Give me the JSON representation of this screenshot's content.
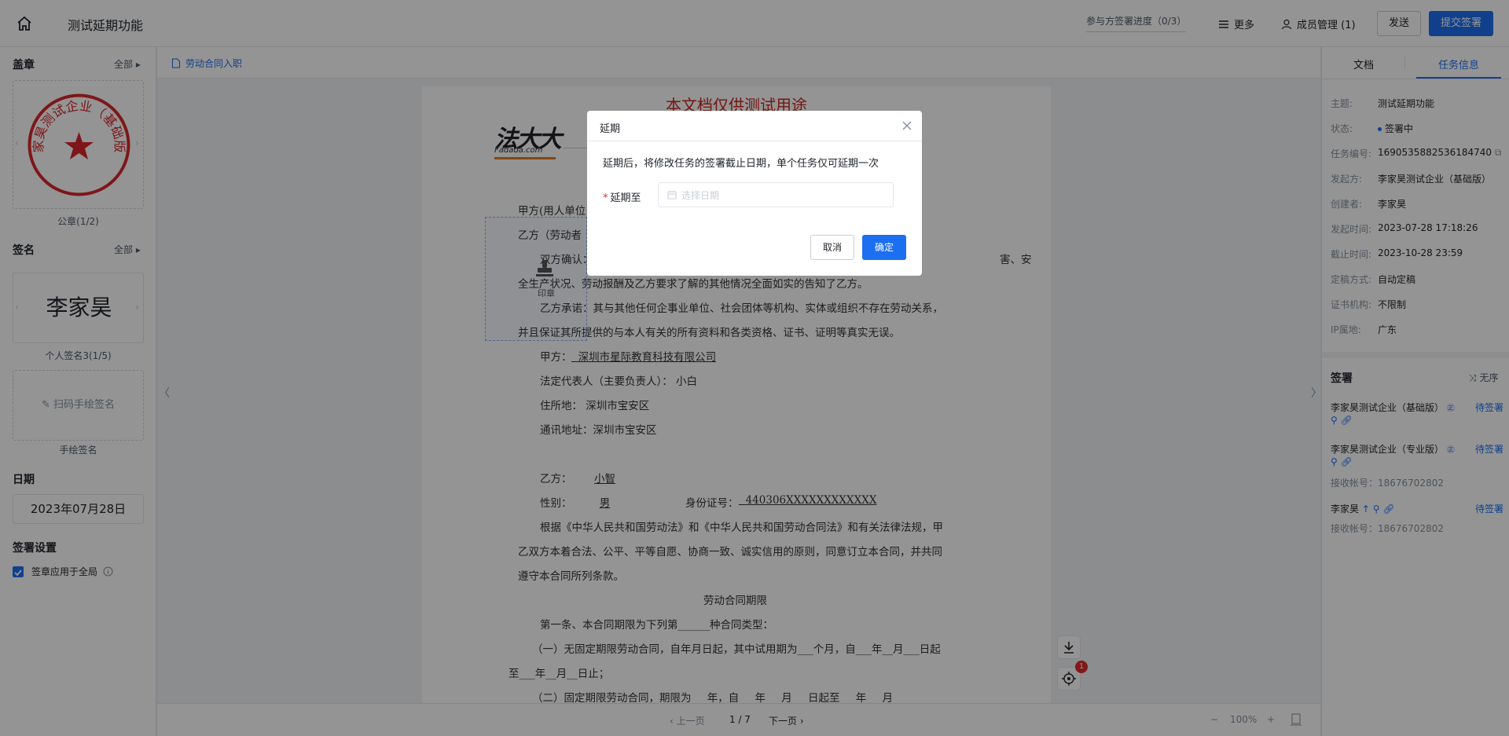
{
  "header": {
    "title": "测试延期功能",
    "progress": "参与方签署进度（0/3）",
    "more": "更多",
    "members": "成员管理 (1)",
    "send": "发送",
    "submit": "提交签署"
  },
  "left_panel": {
    "seal_heading": "盖章",
    "seal_all": "全部",
    "seal_text": "李家昊测试企业（基础版）",
    "seal_caption": "公章(1/2)",
    "sign_heading": "签名",
    "sign_all": "全部",
    "sign_name": "李家昊",
    "sign_caption": "个人签名3(1/5)",
    "hand_label": "扫码手绘签名",
    "hand_caption": "手绘签名",
    "date_heading": "日期",
    "date_value": "2023年07月28日",
    "settings_heading": "签署设置",
    "apply_all_label": "签章应用于全局",
    "apply_all_checked": true
  },
  "doc_tab": "劳动合同入职",
  "document": {
    "watermark": "本文档仅供测试用途",
    "logo_main": "法大大",
    "logo_sub": "Fadada.com",
    "stamp_label": "印章",
    "lines": [
      "甲方(用人单位",
      "乙方（劳动者",
      "双方确认：",
      "害、安",
      "全生产状况、劳动报酬及乙方要求了解的其他情况全面如实的告知了乙方。",
      "乙方承诺：其与其他任何企事业单位、社会团体等机构、实体或组织不存在劳动关系，",
      "并且保证其所提供的与本人有关的所有资料和各类资格、证书、证明等真实无误。",
      "甲方：",
      "深圳市星际教育科技有限公司",
      "法定代表人（主要负责人）：  小白",
      "住所地：    深圳市宝安区",
      "通讯地址：深圳市宝安区",
      "乙方：",
      "小智",
      "性别：",
      "男",
      "身份证号：",
      "440306XXXXXXXXXXXX",
      "根据《中华人民共和国劳动法》和《中华人民共和国劳动合同法》和有关法律法规，甲",
      "乙双方本着合法、公平、平等自愿、协商一致、诚实信用的原则，同意订立本合同，并共同",
      "遵守本合同所列条款。",
      "劳动合同期限",
      "第一条、本合同期限为下列第______种合同类型：",
      "（一）无固定期限劳动合同，自年月日起，其中试用期为___个月，自___年__月___日起",
      "至___年__月__日止；",
      "（二）固定期限劳动合同，期限为___年，自___年___月___日起至___年___月"
    ]
  },
  "bottom": {
    "prev": "上一页",
    "page_indicator": "1 / 7",
    "next": "下一页",
    "zoom": "100%"
  },
  "float_badge": "1",
  "right_panel": {
    "tabs": [
      "文档",
      "任务信息"
    ],
    "active_tab": "任务信息",
    "info": [
      {
        "k": "主题:",
        "v": "测试延期功能"
      },
      {
        "k": "状态:",
        "v": "签署中"
      },
      {
        "k": "任务编号:",
        "v": "1690535882536184740"
      },
      {
        "k": "发起方:",
        "v": "李家昊测试企业（基础版）"
      },
      {
        "k": "创建者:",
        "v": "李家昊"
      },
      {
        "k": "发起时间:",
        "v": "2023-07-28 17:18:26"
      },
      {
        "k": "截止时间:",
        "v": "2023-10-28 23:59"
      },
      {
        "k": "定稿方式:",
        "v": "自动定稿"
      },
      {
        "k": "证书机构:",
        "v": "不限制"
      },
      {
        "k": "IP属地:",
        "v": "广东"
      }
    ],
    "sign_heading": "签署",
    "order_label": "无序",
    "signers": [
      {
        "name": "李家昊测试企业（基础版）",
        "status": "待签署",
        "account": ""
      },
      {
        "name": "李家昊测试企业（专业版）",
        "status": "待签署",
        "account": "接收帐号：18676702802"
      },
      {
        "name": "李家昊",
        "status": "待签署",
        "account": "接收帐号：18676702802"
      }
    ]
  },
  "modal": {
    "title": "延期",
    "description": "延期后，将修改任务的签署截止日期，单个任务仅可延期一次",
    "field_label": "延期至",
    "placeholder": "选择日期",
    "cancel": "取消",
    "confirm": "确定"
  },
  "colors": {
    "primary": "#1d6ff2",
    "seal_red": "#d9262c",
    "watermark_red": "#c8261c"
  }
}
